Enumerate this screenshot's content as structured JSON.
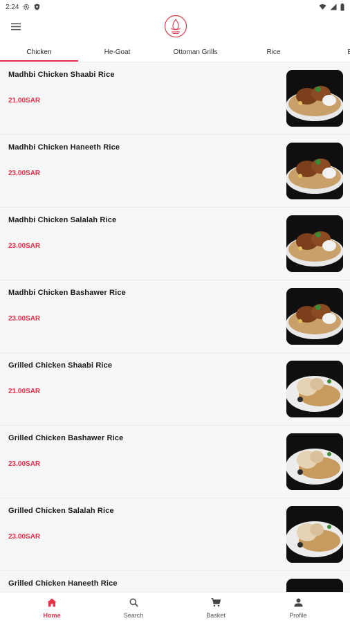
{
  "status_bar": {
    "time": "2:24",
    "icons": [
      "gear-icon",
      "shield-icon",
      "wifi-icon",
      "signal-icon",
      "battery-icon"
    ]
  },
  "header": {
    "menu_icon": "hamburger-menu-icon",
    "logo_icon": "restaurant-logo-icon"
  },
  "tabs": [
    {
      "label": "Chicken",
      "active": true
    },
    {
      "label": "He-Goat",
      "active": false
    },
    {
      "label": "Ottoman Grills",
      "active": false
    },
    {
      "label": "Rice",
      "active": false
    },
    {
      "label": "Ed",
      "active": false
    }
  ],
  "items": [
    {
      "name": "Madhbi Chicken Shaabi Rice",
      "price": "21.00SAR",
      "image": "madhbi"
    },
    {
      "name": "Madhbi Chicken Haneeth Rice",
      "price": "23.00SAR",
      "image": "madhbi"
    },
    {
      "name": "Madhbi Chicken Salalah Rice",
      "price": "23.00SAR",
      "image": "madhbi"
    },
    {
      "name": "Madhbi Chicken Bashawer Rice",
      "price": "23.00SAR",
      "image": "madhbi"
    },
    {
      "name": "Grilled Chicken Shaabi Rice",
      "price": "21.00SAR",
      "image": "grilled"
    },
    {
      "name": "Grilled Chicken Bashawer Rice",
      "price": "23.00SAR",
      "image": "grilled"
    },
    {
      "name": "Grilled Chicken Salalah Rice",
      "price": "23.00SAR",
      "image": "grilled"
    },
    {
      "name": "Grilled Chicken Haneeth Rice",
      "price": "",
      "image": "grilled"
    }
  ],
  "bottom_nav": [
    {
      "label": "Home",
      "icon": "home-icon",
      "active": true
    },
    {
      "label": "Search",
      "icon": "search-icon",
      "active": false
    },
    {
      "label": "Basket",
      "icon": "cart-icon",
      "active": false
    },
    {
      "label": "Profile",
      "icon": "profile-icon",
      "active": false
    }
  ],
  "colors": {
    "accent": "#e8334a",
    "list_background": "#f7f7f7"
  }
}
